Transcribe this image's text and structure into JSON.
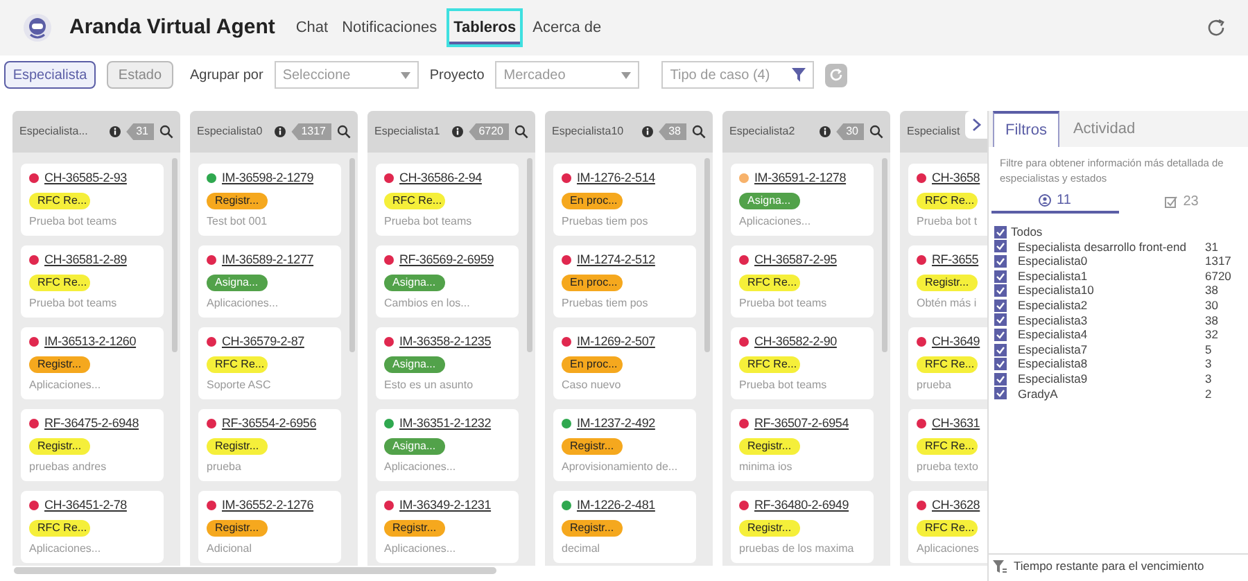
{
  "header": {
    "title": "Aranda Virtual Agent",
    "nav": [
      {
        "label": "Chat",
        "selected": false
      },
      {
        "label": "Notificaciones",
        "selected": false
      },
      {
        "label": "Tableros",
        "selected": true
      },
      {
        "label": "Acerca de",
        "selected": false
      }
    ]
  },
  "toolbar": {
    "views": [
      {
        "label": "Especialista",
        "selected": true
      },
      {
        "label": "Estado",
        "selected": false
      }
    ],
    "group_label": "Agrupar por",
    "group_select": {
      "placeholder": "Seleccione"
    },
    "project_label": "Proyecto",
    "project_select": {
      "value": "Mercadeo"
    },
    "case_type": {
      "placeholder": "Tipo de caso (4)"
    }
  },
  "columns": [
    {
      "title": "Especialista...",
      "count": "31",
      "cards": [
        {
          "id": "CH-36585-2-93",
          "color": "#e0284f",
          "status": {
            "label": "RFC Re...",
            "color": "#f5ef3a"
          },
          "description": "Prueba bot teams"
        },
        {
          "id": "CH-36581-2-89",
          "color": "#e0284f",
          "status": {
            "label": "RFC Re...",
            "color": "#f5ef3a"
          },
          "description": "Prueba bot teams"
        },
        {
          "id": "IM-36513-2-1260",
          "color": "#e0284f",
          "status": {
            "label": "Registr...",
            "color": "#f5a81e"
          },
          "description": "Aplicaciones..."
        },
        {
          "id": "RF-36475-2-6948",
          "color": "#e0284f",
          "status": {
            "label": "Registr...",
            "color": "#f5ef3a"
          },
          "description": "pruebas andres"
        },
        {
          "id": "CH-36451-2-78",
          "color": "#e0284f",
          "status": {
            "label": "RFC Re...",
            "color": "#f5ef3a"
          },
          "description": "Aplicaciones..."
        }
      ]
    },
    {
      "title": "Especialista0",
      "count": "1317",
      "cards": [
        {
          "id": "IM-36598-2-1279",
          "color": "#2fa84f",
          "status": {
            "label": "Registr...",
            "color": "#f5a81e"
          },
          "description": "Test bot 001"
        },
        {
          "id": "IM-36589-2-1277",
          "color": "#e0284f",
          "status": {
            "label": "Asigna...",
            "color": "#52a24a"
          },
          "description": "Aplicaciones..."
        },
        {
          "id": "CH-36579-2-87",
          "color": "#e0284f",
          "status": {
            "label": "RFC Re...",
            "color": "#f5ef3a"
          },
          "description": "Soporte ASC"
        },
        {
          "id": "RF-36554-2-6956",
          "color": "#e0284f",
          "status": {
            "label": "Registr...",
            "color": "#f5ef3a"
          },
          "description": "prueba"
        },
        {
          "id": "IM-36552-2-1276",
          "color": "#e0284f",
          "status": {
            "label": "Registr...",
            "color": "#f5a81e"
          },
          "description": "Adicional"
        }
      ]
    },
    {
      "title": "Especialista1",
      "count": "6720",
      "cards": [
        {
          "id": "CH-36586-2-94",
          "color": "#e0284f",
          "status": {
            "label": "RFC Re...",
            "color": "#f5ef3a"
          },
          "description": "Prueba bot teams"
        },
        {
          "id": "RF-36569-2-6959",
          "color": "#e0284f",
          "status": {
            "label": "Asigna...",
            "color": "#52a24a"
          },
          "description": "Cambios en los..."
        },
        {
          "id": "IM-36358-2-1235",
          "color": "#e0284f",
          "status": {
            "label": "Asigna...",
            "color": "#52a24a"
          },
          "description": "Esto es un asunto"
        },
        {
          "id": "IM-36351-2-1232",
          "color": "#2fa84f",
          "status": {
            "label": "Asigna...",
            "color": "#52a24a"
          },
          "description": "Aplicaciones..."
        },
        {
          "id": "IM-36349-2-1231",
          "color": "#e0284f",
          "status": {
            "label": "Registr...",
            "color": "#f5a81e"
          },
          "description": "Aplicaciones..."
        }
      ]
    },
    {
      "title": "Especialista10",
      "count": "38",
      "cards": [
        {
          "id": "IM-1276-2-514",
          "color": "#e0284f",
          "status": {
            "label": "En proc...",
            "color": "#f5a81e"
          },
          "description": "Pruebas tiem pos"
        },
        {
          "id": "IM-1274-2-512",
          "color": "#e0284f",
          "status": {
            "label": "En proc...",
            "color": "#f5a81e"
          },
          "description": "Pruebas tiem pos"
        },
        {
          "id": "IM-1269-2-507",
          "color": "#e0284f",
          "status": {
            "label": "En proc...",
            "color": "#f5a81e"
          },
          "description": "Caso nuevo"
        },
        {
          "id": "IM-1237-2-492",
          "color": "#2fa84f",
          "status": {
            "label": "Registr...",
            "color": "#f5a81e"
          },
          "description": "Aprovisionamiento de..."
        },
        {
          "id": "IM-1226-2-481",
          "color": "#2fa84f",
          "status": {
            "label": "Registr...",
            "color": "#f5a81e"
          },
          "description": "decimal"
        }
      ]
    },
    {
      "title": "Especialista2",
      "count": "30",
      "cards": [
        {
          "id": "IM-36591-2-1278",
          "color": "#f7b26b",
          "status": {
            "label": "Asigna...",
            "color": "#52a24a"
          },
          "description": "Aplicaciones..."
        },
        {
          "id": "CH-36587-2-95",
          "color": "#e0284f",
          "status": {
            "label": "RFC Re...",
            "color": "#f5ef3a"
          },
          "description": "Prueba bot teams"
        },
        {
          "id": "CH-36582-2-90",
          "color": "#e0284f",
          "status": {
            "label": "RFC Re...",
            "color": "#f5ef3a"
          },
          "description": "Prueba bot teams"
        },
        {
          "id": "RF-36507-2-6954",
          "color": "#e0284f",
          "status": {
            "label": "Registr...",
            "color": "#f5ef3a"
          },
          "description": "minima ios"
        },
        {
          "id": "RF-36480-2-6949",
          "color": "#e0284f",
          "status": {
            "label": "Registr...",
            "color": "#f5ef3a"
          },
          "description": "pruebas de los maxima"
        }
      ]
    },
    {
      "title": "Especialist",
      "cards": [
        {
          "id": "CH-3658",
          "color": "#e0284f",
          "status": {
            "label": "RFC Re...",
            "color": "#f5ef3a"
          },
          "description": "Prueba bot t"
        },
        {
          "id": "RF-3655",
          "color": "#e0284f",
          "status": {
            "label": "Registr...",
            "color": "#f5ef3a"
          },
          "description": "Obtén más i"
        },
        {
          "id": "CH-3649",
          "color": "#e0284f",
          "status": {
            "label": "RFC Re...",
            "color": "#f5ef3a"
          },
          "description": "prueba"
        },
        {
          "id": "CH-3631",
          "color": "#e0284f",
          "status": {
            "label": "RFC Re...",
            "color": "#f5ef3a"
          },
          "description": "prueba texto"
        },
        {
          "id": "CH-3628",
          "color": "#e0284f",
          "status": {
            "label": "RFC Re...",
            "color": "#f5ef3a"
          },
          "description": "Aplicaciones"
        }
      ]
    }
  ],
  "panel": {
    "tabs": [
      {
        "label": "Filtros",
        "selected": true
      },
      {
        "label": "Actividad",
        "selected": false
      }
    ],
    "description": "Filtre para obtener información más detallada de especialistas y estados",
    "subtabs": [
      {
        "kind": "people",
        "label": "11",
        "selected": true
      },
      {
        "kind": "states",
        "label": "23",
        "selected": false
      }
    ],
    "all": {
      "label": "Todos",
      "checked": true
    },
    "items": [
      {
        "label": "Especialista desarrollo front-end",
        "count": "31",
        "checked": true
      },
      {
        "label": "Especialista0",
        "count": "1317",
        "checked": true
      },
      {
        "label": "Especialista1",
        "count": "6720",
        "checked": true
      },
      {
        "label": "Especialista10",
        "count": "38",
        "checked": true
      },
      {
        "label": "Especialista2",
        "count": "30",
        "checked": true
      },
      {
        "label": "Especialista3",
        "count": "38",
        "checked": true
      },
      {
        "label": "Especialista4",
        "count": "32",
        "checked": true
      },
      {
        "label": "Especialista7",
        "count": "5",
        "checked": true
      },
      {
        "label": "Especialista8",
        "count": "3",
        "checked": true
      },
      {
        "label": "Especialista9",
        "count": "3",
        "checked": true
      },
      {
        "label": "GradyA",
        "count": "2",
        "checked": true
      }
    ],
    "footer": "Tiempo restante para el vencimiento"
  }
}
